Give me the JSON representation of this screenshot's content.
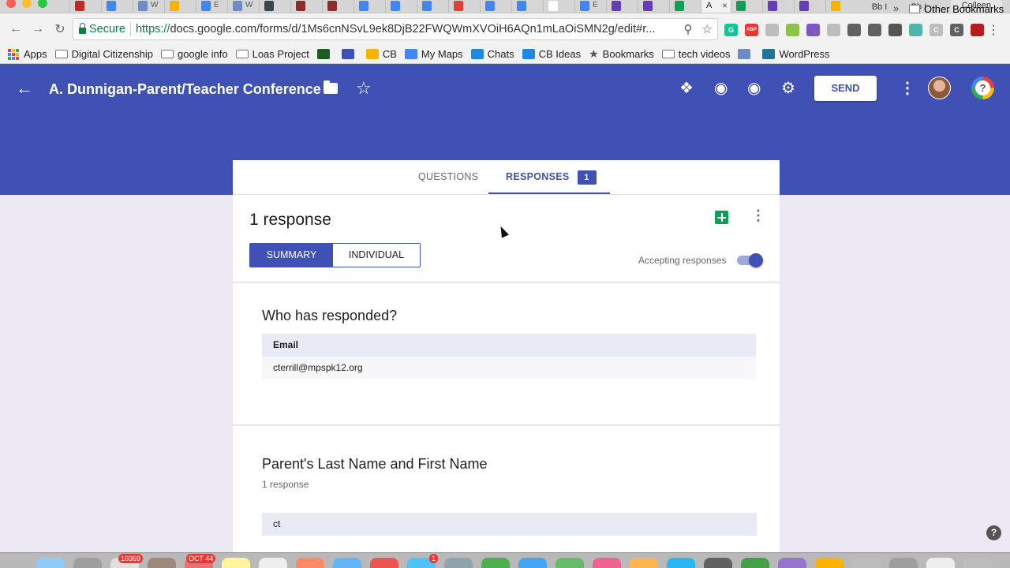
{
  "browser": {
    "tabs": [
      {
        "fav": "#c62828",
        "text": ""
      },
      {
        "fav": "#4285f4",
        "text": ""
      },
      {
        "fav": "#6d8bc7",
        "text": "W"
      },
      {
        "fav": "#f4b400",
        "text": ""
      },
      {
        "fav": "#4285f4",
        "text": "E"
      },
      {
        "fav": "#6d8bc7",
        "text": "W"
      },
      {
        "fav": "#37474f",
        "text": ""
      },
      {
        "fav": "#8e2b2b",
        "text": ""
      },
      {
        "fav": "#8e2b2b",
        "text": ""
      },
      {
        "fav": "#4285f4",
        "text": ""
      },
      {
        "fav": "#4285f4",
        "text": ""
      },
      {
        "fav": "#4285f4",
        "text": ""
      },
      {
        "fav": "#db4437",
        "text": ""
      },
      {
        "fav": "#4285f4",
        "text": ""
      },
      {
        "fav": "#4285f4",
        "text": ""
      },
      {
        "fav": "#ffffff",
        "text": ""
      },
      {
        "fav": "#4285f4",
        "text": "E"
      },
      {
        "fav": "#673ab7",
        "text": ""
      },
      {
        "fav": "#673ab7",
        "text": ""
      },
      {
        "fav": "#0f9d58",
        "text": ""
      }
    ],
    "active_tab": {
      "text": "A",
      "close": "×"
    },
    "tabs_after": [
      {
        "fav": "#0f9d58",
        "text": ""
      },
      {
        "fav": "#673ab7",
        "text": ""
      },
      {
        "fav": "#673ab7",
        "text": ""
      },
      {
        "fav": "#f4b400",
        "text": ""
      }
    ],
    "bb_tabs": [
      "Bb I",
      "Bb I"
    ],
    "user_name": "Colleen",
    "address": {
      "secure_label": "Secure",
      "scheme": "https://",
      "url_rest": "docs.google.com/forms/d/1Ms6cnNSvL9ek8DjB22FWQWmXVOiH6AQn1mLaOiSMN2g/edit#r..."
    },
    "extensions": [
      {
        "color": "#15c39a",
        "text": "G"
      },
      {
        "color": "#e53935",
        "text": "ABP"
      },
      {
        "color": "#bdbdbd",
        "text": ""
      },
      {
        "color": "#8bc34a",
        "text": ""
      },
      {
        "color": "#7e57c2",
        "text": ""
      },
      {
        "color": "#bdbdbd",
        "text": ""
      },
      {
        "color": "#616161",
        "text": ""
      },
      {
        "color": "#616161",
        "text": ""
      },
      {
        "color": "#555555",
        "text": ""
      },
      {
        "color": "#4db6ac",
        "text": ""
      },
      {
        "color": "#bdbdbd",
        "text": "C"
      },
      {
        "color": "#616161",
        "text": "C"
      },
      {
        "color": "#b71c1c",
        "text": ""
      }
    ],
    "bookmarks": [
      {
        "label": "Apps",
        "kind": "apps"
      },
      {
        "label": "Digital Citizenship",
        "kind": "folder"
      },
      {
        "label": "google info",
        "kind": "folder"
      },
      {
        "label": "Loas Project",
        "kind": "folder"
      },
      {
        "label": "",
        "kind": "icon",
        "color": "#1b5e20"
      },
      {
        "label": "",
        "kind": "icon",
        "color": "#3f51b5"
      },
      {
        "label": "CB",
        "kind": "icon",
        "color": "#f4b400"
      },
      {
        "label": "My Maps",
        "kind": "icon",
        "color": "#4285f4"
      },
      {
        "label": "Chats",
        "kind": "icon",
        "color": "#1e88e5"
      },
      {
        "label": "CB Ideas",
        "kind": "icon",
        "color": "#1e88e5"
      },
      {
        "label": "Bookmarks",
        "kind": "star"
      },
      {
        "label": "tech videos",
        "kind": "folder"
      },
      {
        "label": "",
        "kind": "icon",
        "color": "#6d8bc7"
      },
      {
        "label": "WordPress",
        "kind": "icon",
        "color": "#21759b"
      }
    ],
    "bookmarks_more": "»",
    "other_bookmarks": "Other Bookmarks"
  },
  "header": {
    "title": "A. Dunnigan-Parent/Teacher Conference",
    "send_label": "SEND",
    "help_glyph": "?",
    "brand_color": "#3f51b5"
  },
  "tabs": {
    "questions": "QUESTIONS",
    "responses": "RESPONSES",
    "responses_count": "1"
  },
  "summary": {
    "title": "1 response",
    "summary_label": "SUMMARY",
    "individual_label": "INDIVIDUAL",
    "accepting_label": "Accepting responses",
    "accepting": true
  },
  "who": {
    "title": "Who has responded?",
    "column": "Email",
    "emails": [
      "cterrill@mpspk12.org"
    ]
  },
  "parent_question": {
    "title": "Parent's Last Name and First Name",
    "count": "1 response",
    "answers": [
      "ct"
    ]
  },
  "help_fab": "?",
  "dock": {
    "badges": [
      "10369",
      "OCT 44",
      "1"
    ]
  }
}
